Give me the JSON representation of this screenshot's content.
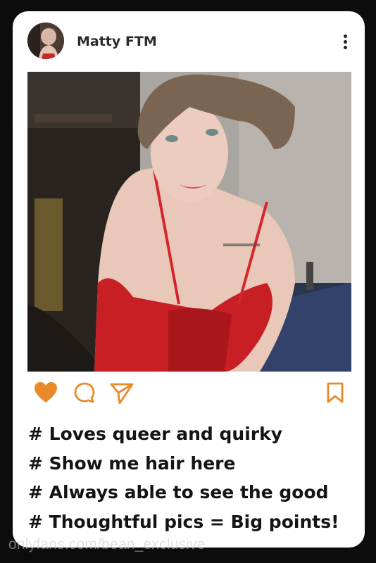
{
  "post": {
    "username": "Matty FTM",
    "avatar_icon": "user-avatar",
    "photo_subject": "selfie-photo"
  },
  "actions": {
    "like_icon": "heart-icon",
    "like_color": "#e8892a",
    "comment_icon": "comment-icon",
    "share_icon": "send-icon",
    "save_icon": "bookmark-icon",
    "icon_color": "#e8892a"
  },
  "captions": [
    "# Loves queer and quirky",
    "# Show me hair here",
    "# Always able to see the good",
    "# Thoughtful pics = Big points!"
  ],
  "watermark": "onlyfans.com/bean_exclusive"
}
